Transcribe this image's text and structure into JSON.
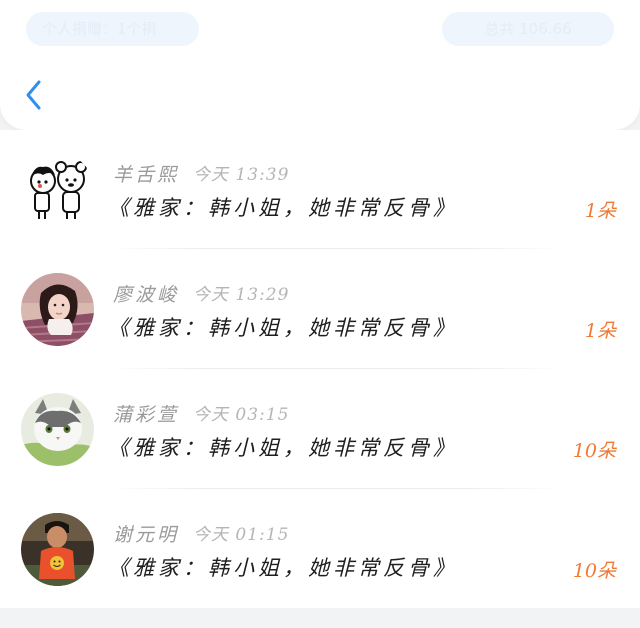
{
  "header": {
    "left_pill": "个人捐赠：1个捐",
    "right_pill": "总共 106.66",
    "back_icon": "chevron-left-icon",
    "accent_color": "#2f8ff0"
  },
  "rows": [
    {
      "avatar": "cartoon-couple-avatar",
      "name": "羊舌熙",
      "time": "今天 13:39",
      "title": "《雅家：韩小姐，她非常反骨》",
      "count": "1朵"
    },
    {
      "avatar": "girl-photo-avatar",
      "name": "廖波峻",
      "time": "今天 13:29",
      "title": "《雅家：韩小姐，她非常反骨》",
      "count": "1朵"
    },
    {
      "avatar": "cat-photo-avatar",
      "name": "蒲彩萱",
      "time": "今天 03:15",
      "title": "《雅家：韩小姐，她非常反骨》",
      "count": "10朵"
    },
    {
      "avatar": "man-photo-avatar",
      "name": "谢元明",
      "time": "今天 01:15",
      "title": "《雅家：韩小姐，她非常反骨》",
      "count": "10朵"
    }
  ],
  "colors": {
    "count": "#f07a36",
    "name": "#9a9a9a",
    "title": "#1f1f1f"
  }
}
